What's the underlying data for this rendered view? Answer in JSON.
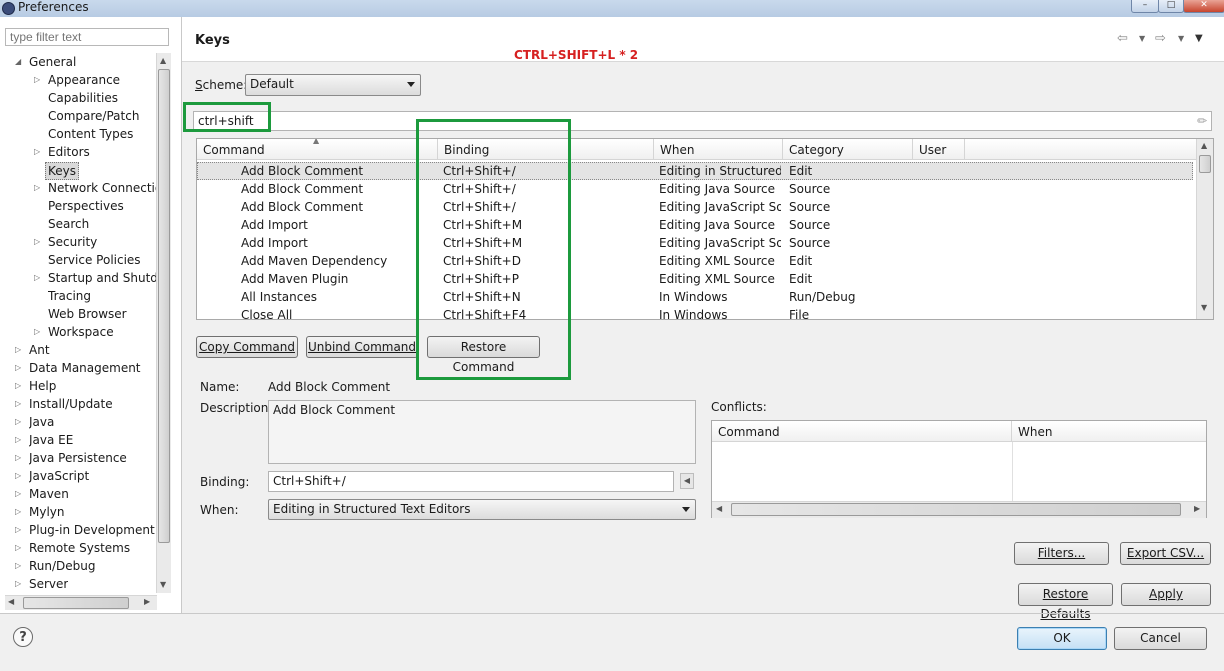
{
  "window": {
    "title": "Preferences"
  },
  "filter": {
    "placeholder": "type filter text"
  },
  "tree": {
    "items": [
      {
        "label": "General",
        "level": 0,
        "expanded": true
      },
      {
        "label": "Appearance",
        "level": 1,
        "hasChildren": true
      },
      {
        "label": "Capabilities",
        "level": 1,
        "hasChildren": false
      },
      {
        "label": "Compare/Patch",
        "level": 1,
        "hasChildren": false
      },
      {
        "label": "Content Types",
        "level": 1,
        "hasChildren": false
      },
      {
        "label": "Editors",
        "level": 1,
        "hasChildren": true
      },
      {
        "label": "Keys",
        "level": 1,
        "hasChildren": false,
        "selected": true
      },
      {
        "label": "Network Connection",
        "level": 1,
        "hasChildren": true
      },
      {
        "label": "Perspectives",
        "level": 1,
        "hasChildren": false
      },
      {
        "label": "Search",
        "level": 1,
        "hasChildren": false
      },
      {
        "label": "Security",
        "level": 1,
        "hasChildren": true
      },
      {
        "label": "Service Policies",
        "level": 1,
        "hasChildren": false
      },
      {
        "label": "Startup and Shutdow",
        "level": 1,
        "hasChildren": true
      },
      {
        "label": "Tracing",
        "level": 1,
        "hasChildren": false
      },
      {
        "label": "Web Browser",
        "level": 1,
        "hasChildren": false
      },
      {
        "label": "Workspace",
        "level": 1,
        "hasChildren": true
      },
      {
        "label": "Ant",
        "level": 0,
        "hasChildren": true
      },
      {
        "label": "Data Management",
        "level": 0,
        "hasChildren": true
      },
      {
        "label": "Help",
        "level": 0,
        "hasChildren": true
      },
      {
        "label": "Install/Update",
        "level": 0,
        "hasChildren": true
      },
      {
        "label": "Java",
        "level": 0,
        "hasChildren": true
      },
      {
        "label": "Java EE",
        "level": 0,
        "hasChildren": true
      },
      {
        "label": "Java Persistence",
        "level": 0,
        "hasChildren": true
      },
      {
        "label": "JavaScript",
        "level": 0,
        "hasChildren": true
      },
      {
        "label": "Maven",
        "level": 0,
        "hasChildren": true
      },
      {
        "label": "Mylyn",
        "level": 0,
        "hasChildren": true
      },
      {
        "label": "Plug-in Development",
        "level": 0,
        "hasChildren": true
      },
      {
        "label": "Remote Systems",
        "level": 0,
        "hasChildren": true
      },
      {
        "label": "Run/Debug",
        "level": 0,
        "hasChildren": true
      },
      {
        "label": "Server",
        "level": 0,
        "hasChildren": true
      }
    ]
  },
  "page": {
    "title": "Keys",
    "annotation": "CTRL+SHIFT+L * 2",
    "annotation_color": "#d62020",
    "highlight_color": "#1c9a3d"
  },
  "scheme": {
    "label": "Scheme:",
    "value": "Default"
  },
  "search": {
    "value": "ctrl+shift"
  },
  "table": {
    "columns": [
      "Command",
      "Binding",
      "When",
      "Category",
      "User"
    ],
    "rows": [
      [
        "Add Block Comment",
        "Ctrl+Shift+/",
        "Editing in Structured ...",
        "Edit",
        ""
      ],
      [
        "Add Block Comment",
        "Ctrl+Shift+/",
        "Editing Java Source",
        "Source",
        ""
      ],
      [
        "Add Block Comment",
        "Ctrl+Shift+/",
        "Editing JavaScript So...",
        "Source",
        ""
      ],
      [
        "Add Import",
        "Ctrl+Shift+M",
        "Editing Java Source",
        "Source",
        ""
      ],
      [
        "Add Import",
        "Ctrl+Shift+M",
        "Editing JavaScript So...",
        "Source",
        ""
      ],
      [
        "Add Maven Dependency",
        "Ctrl+Shift+D",
        "Editing XML Source",
        "Edit",
        ""
      ],
      [
        "Add Maven Plugin",
        "Ctrl+Shift+P",
        "Editing XML Source",
        "Edit",
        ""
      ],
      [
        "All Instances",
        "Ctrl+Shift+N",
        "In Windows",
        "Run/Debug",
        ""
      ],
      [
        "Close All",
        "Ctrl+Shift+F4",
        "In Windows",
        "File",
        ""
      ]
    ]
  },
  "buttons": {
    "copy_command": "Copy Command",
    "unbind_command": "Unbind Command",
    "restore_command": "Restore Command",
    "filters": "Filters...",
    "export_csv": "Export CSV...",
    "restore_defaults": "Restore Defaults",
    "apply": "Apply",
    "ok": "OK",
    "cancel": "Cancel"
  },
  "details": {
    "name_label": "Name:",
    "name_value": "Add Block Comment",
    "description_label": "Description:",
    "description_value": "Add Block Comment",
    "binding_label": "Binding:",
    "binding_value": "Ctrl+Shift+/",
    "when_label": "When:",
    "when_value": "Editing in Structured Text Editors"
  },
  "conflicts": {
    "label": "Conflicts:",
    "columns": [
      "Command",
      "When"
    ]
  }
}
